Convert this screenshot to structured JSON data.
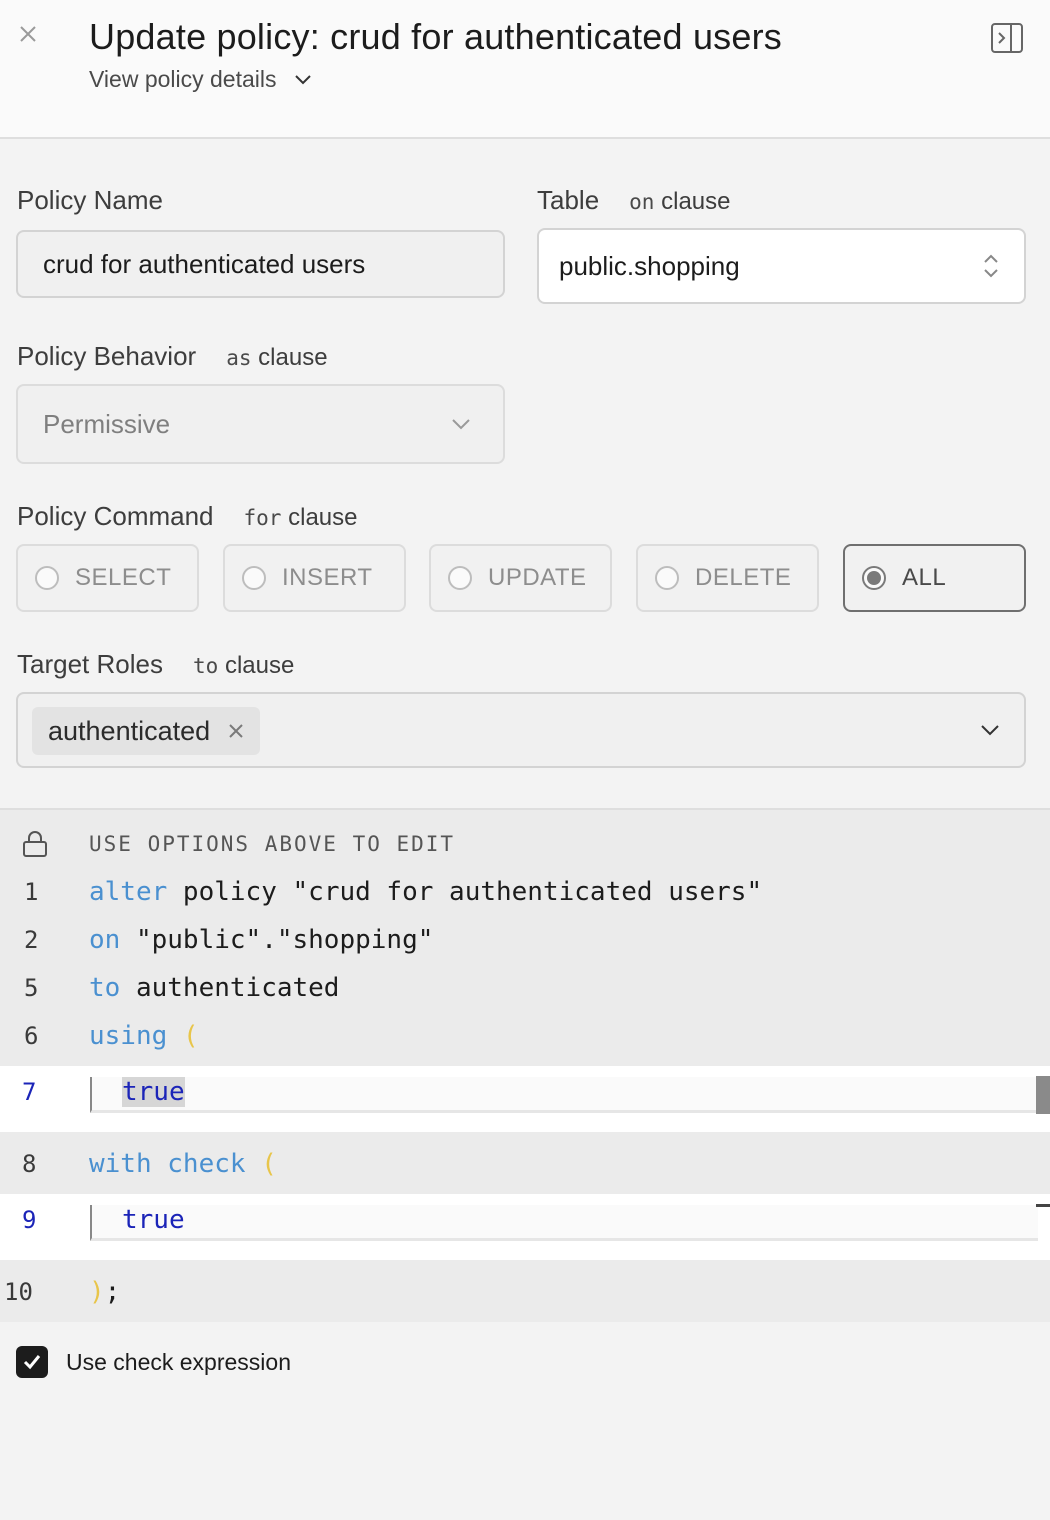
{
  "header": {
    "title": "Update policy: crud for authenticated users",
    "details_toggle": "View policy details"
  },
  "form": {
    "policy_name": {
      "label": "Policy Name",
      "value": "crud for authenticated users"
    },
    "table": {
      "label": "Table",
      "clause_kw": "on",
      "clause": "clause",
      "value": "public.shopping"
    },
    "behavior": {
      "label": "Policy Behavior",
      "clause_kw": "as",
      "clause": "clause",
      "value": "Permissive"
    },
    "command": {
      "label": "Policy Command",
      "clause_kw": "for",
      "clause": "clause",
      "options": [
        "SELECT",
        "INSERT",
        "UPDATE",
        "DELETE",
        "ALL"
      ],
      "selected": "ALL"
    },
    "roles": {
      "label": "Target Roles",
      "clause_kw": "to",
      "clause": "clause",
      "chips": [
        "authenticated"
      ]
    }
  },
  "editor": {
    "lock_hint": "USE OPTIONS ABOVE TO EDIT",
    "lines": [
      {
        "num": "1",
        "kw": "alter",
        "rest": " policy \"crud for authenticated users\""
      },
      {
        "num": "2",
        "kw": "on",
        "rest": " \"public\".\"shopping\""
      },
      {
        "num": "5",
        "kw": "to",
        "rest": " authenticated"
      },
      {
        "num": "6",
        "kw": "using",
        "paren": "("
      },
      {
        "num": "7",
        "value": "true"
      },
      {
        "num": "8",
        "kw": "with check",
        "paren": "("
      },
      {
        "num": "9",
        "value": "true"
      },
      {
        "num": "10",
        "paren": ")",
        "rest": ";"
      }
    ]
  },
  "check_expression": {
    "label": "Use check expression",
    "checked": true
  },
  "colors": {
    "keyword": "#4a90d0",
    "paren": "#e8c54a",
    "editable_value": "#1b24b8"
  }
}
